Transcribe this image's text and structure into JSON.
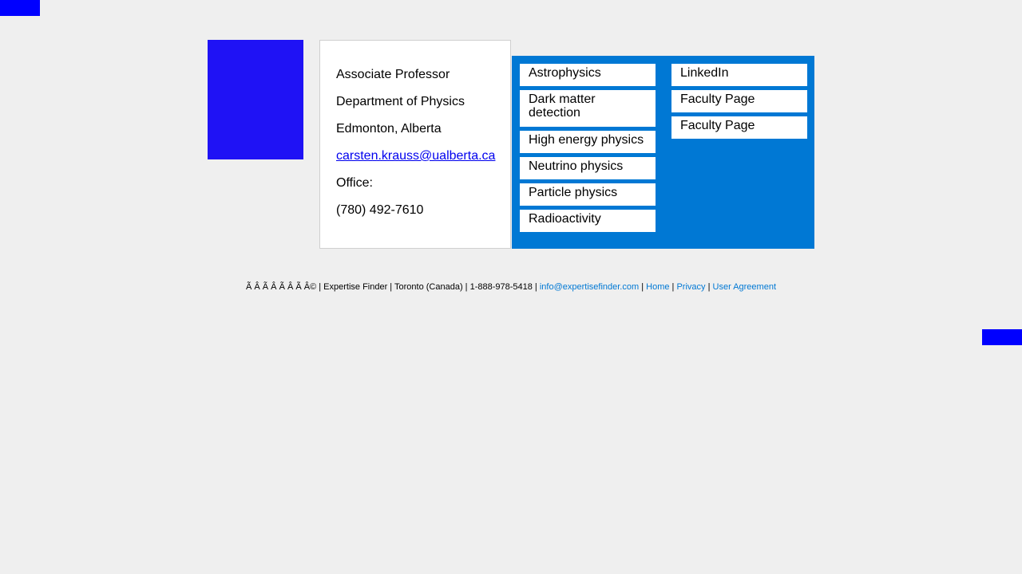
{
  "info": {
    "title": "Associate Professor",
    "department": "Department of Physics",
    "location": "Edmonton, Alberta",
    "email": "carsten.krauss@ualberta.ca",
    "office_label": "Office:",
    "phone": "(780) 492-7610"
  },
  "topics": [
    "Astrophysics",
    "Dark matter detection",
    "High energy physics",
    "Neutrino physics",
    "Particle physics",
    "Radioactivity"
  ],
  "links": [
    "LinkedIn",
    "Faculty Page",
    "Faculty Page"
  ],
  "footer": {
    "copyright": "Ã   Â   Ã   Â   Ã   Â   Ã   Â© | Expertise Finder | Toronto (Canada) | 1-888-978-5418 | ",
    "email": "info@expertisefinder.com",
    "sep": " | ",
    "home": "Home",
    "privacy": "Privacy",
    "agreement": "User Agreement"
  },
  "colors": {
    "panel": "#0078d4",
    "photo": "#1f12f5",
    "accent_block": "#0000ff"
  }
}
